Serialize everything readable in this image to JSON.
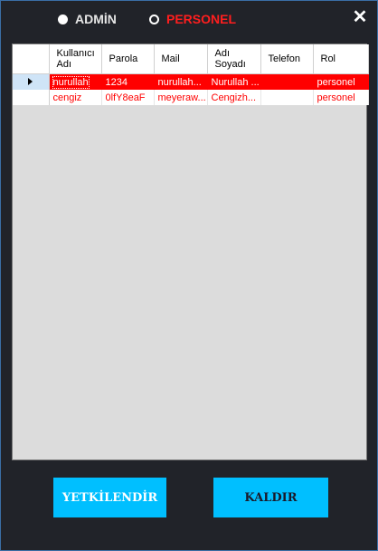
{
  "radios": {
    "admin": {
      "label": "ADMİN",
      "checked": true
    },
    "personel": {
      "label": "PERSONEL",
      "checked": false
    }
  },
  "close_icon": "close-icon",
  "table": {
    "columns": [
      {
        "line1": "Kullanıcı",
        "line2": "Adı"
      },
      {
        "line1": "Parola",
        "line2": ""
      },
      {
        "line1": "Mail",
        "line2": ""
      },
      {
        "line1": "Adı",
        "line2": "Soyadı"
      },
      {
        "line1": "Telefon",
        "line2": ""
      },
      {
        "line1": "Rol",
        "line2": ""
      }
    ],
    "rows": [
      [
        "nurullah",
        "1234",
        "nurullah...",
        "Nurullah ...",
        "",
        "personel"
      ],
      [
        "cengiz",
        "0lfY8eaF",
        "meyeraw...",
        "Cengizh...",
        "",
        "personel"
      ]
    ],
    "selected_row": 0
  },
  "buttons": {
    "authorize": "YETKİLENDİR",
    "remove": "KALDIR"
  },
  "colors": {
    "background": "#212329",
    "accent": "#00bfff",
    "selected_row": "#ff0000",
    "personel_text": "#ff1e1e"
  }
}
